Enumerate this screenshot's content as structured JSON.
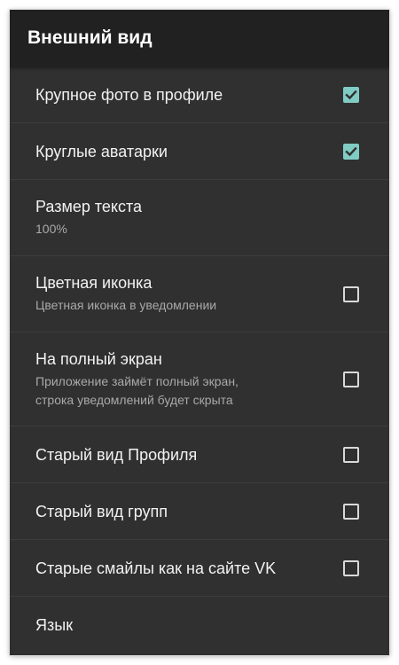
{
  "toolbar": {
    "title": "Внешний вид"
  },
  "accent_color": "#80cbc4",
  "settings": [
    {
      "title": "Крупное фото в профиле",
      "checked": true
    },
    {
      "title": "Круглые аватарки",
      "checked": true
    },
    {
      "title": "Размер текста",
      "subtitle": "100%"
    },
    {
      "title": "Цветная иконка",
      "subtitle": "Цветная иконка в уведомлении",
      "checked": false
    },
    {
      "title": "На полный экран",
      "subtitle_line1": "Приложение займёт полный экран,",
      "subtitle_line2": "строка уведомлений будет скрыта",
      "checked": false
    },
    {
      "title": "Старый вид Профиля",
      "checked": false
    },
    {
      "title": "Старый вид групп",
      "checked": false
    },
    {
      "title": "Старые смайлы как на сайте VK",
      "checked": false
    },
    {
      "title": "Язык"
    }
  ]
}
